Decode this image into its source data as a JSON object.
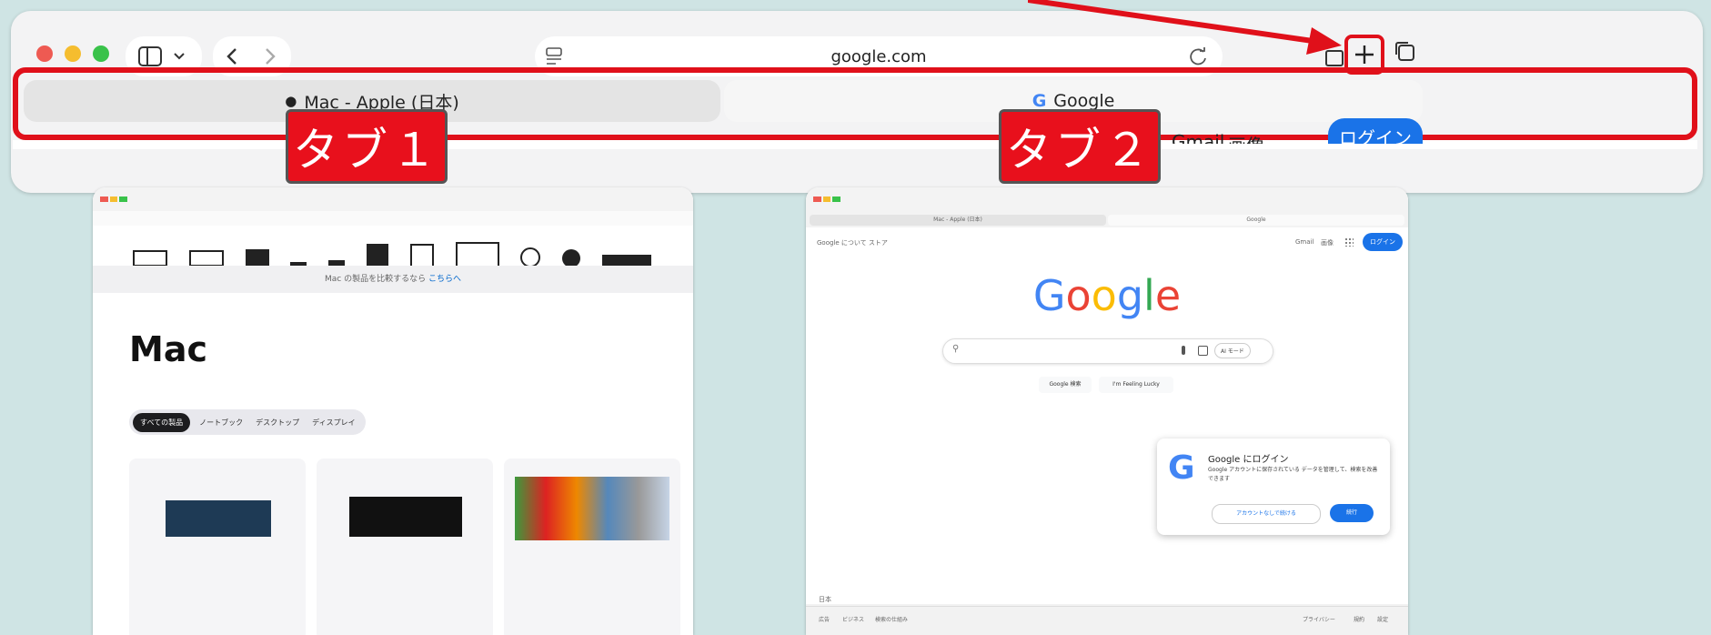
{
  "browser": {
    "address": "google.com",
    "tabs": [
      {
        "label": "Mac - Apple (日本)"
      },
      {
        "label": "Google"
      }
    ]
  },
  "callouts": {
    "tab1": "タブ１",
    "tab2": "タブ２"
  },
  "behind": {
    "left": "Google 検索",
    "right_gmail": "Gmail",
    "right_images": "画像",
    "right_login": "ログイン"
  },
  "left_thumb": {
    "heading": "Mac",
    "notice": "Mac の製品を比較するなら ",
    "notice_link": "こちらへ",
    "chips": [
      "すべての製品",
      "ノートブック",
      "デスクトップ",
      "ディスプレイ"
    ]
  },
  "right_thumb": {
    "tabs": [
      "Mac - Apple (日本)",
      "Google"
    ],
    "top_left": "Google について  ストア",
    "top_right": [
      "Gmail",
      "画像"
    ],
    "login": "ログイン",
    "logo": "Google",
    "search_ai": "AI モード",
    "buttons": [
      "Google 検索",
      "I'm Feeling Lucky"
    ],
    "popup_title": "Google にログイン",
    "popup_text": "Google アカウントに保存されている データを管理して、検索を改善できます",
    "popup_secondary": "アカウントなしで続ける",
    "popup_primary": "続行",
    "footer_country": "日本",
    "footer_links": [
      "広告",
      "ビジネス",
      "検索の仕組み"
    ],
    "footer_right": [
      "プライバシー",
      "規約",
      "設定"
    ]
  },
  "colors": {
    "accent": "#e8101c",
    "google_blue": "#1a73e8",
    "bg": "#cfe4e4"
  }
}
